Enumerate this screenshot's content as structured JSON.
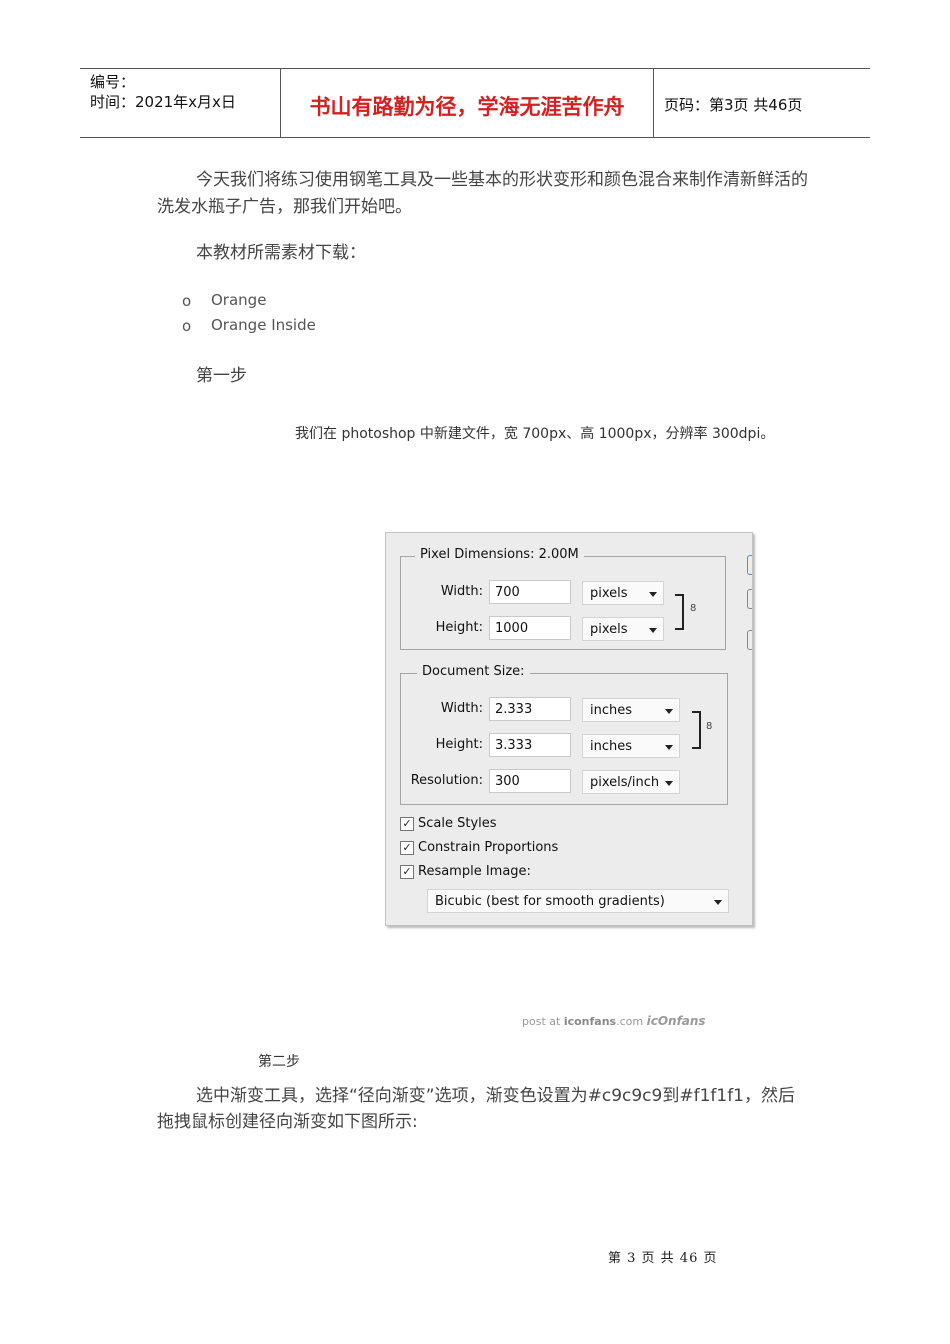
{
  "header": {
    "number_label": "编号：",
    "time_label": "时间：2021年x月x日",
    "motto": "书山有路勤为径，学海无涯苦作舟",
    "page_info": "页码：第3页  共46页"
  },
  "intro": {
    "line1": "今天我们将练习使用钢笔工具及一些基本的形状变形和颜色混合来制作清新鲜活的",
    "line2": "洗发水瓶子广告，那我们开始吧。",
    "materials": "本教材所需素材下载：",
    "bullet_marker": "o",
    "bullets": [
      "Orange",
      "Orange Inside"
    ]
  },
  "step1": {
    "title": "第一步",
    "desc": "我们在 photoshop 中新建文件，宽 700px、高 1000px，分辨率 300dpi。"
  },
  "dialog": {
    "pixel_dimensions_legend": "Pixel Dimensions:  2.00M",
    "width_label": "Width:",
    "height_label": "Height:",
    "pixel_width": "700",
    "pixel_height": "1000",
    "pixel_unit": "pixels",
    "document_size_legend": "Document Size:",
    "doc_width": "2.333",
    "doc_height": "3.333",
    "doc_unit": "inches",
    "resolution_label": "Resolution:",
    "resolution": "300",
    "resolution_unit": "pixels/inch",
    "scale_styles": "Scale Styles",
    "constrain_proportions": "Constrain Proportions",
    "resample_image": "Resample Image:",
    "check_mark": "✓",
    "resample_method": "Bicubic (best for smooth gradients)",
    "chain_glyph": "8"
  },
  "watermark": {
    "prefix": "post at ",
    "site": "iconfans",
    "suffix": ".com",
    "logo": "icOnfans"
  },
  "step2": {
    "title": "第二步",
    "line1": "选中渐变工具，选择“径向渐变”选项，渐变色设置为#c9c9c9到#f1f1f1，然后",
    "line2": "拖拽鼠标创建径向渐变如下图所示:"
  },
  "footer": {
    "page_text": "第 3 页 共 46 页"
  }
}
